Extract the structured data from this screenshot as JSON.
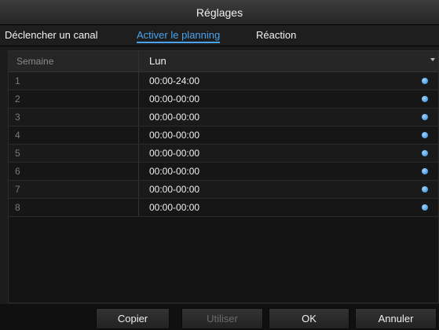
{
  "window": {
    "title": "Réglages"
  },
  "tabs": [
    {
      "label": "Déclencher un canal"
    },
    {
      "label": "Activer le planning"
    },
    {
      "label": "Réaction"
    }
  ],
  "schedule": {
    "day_label": "Semaine",
    "day_value": "Lun",
    "rows": [
      {
        "index": "1",
        "time": "00:00-24:00"
      },
      {
        "index": "2",
        "time": "00:00-00:00"
      },
      {
        "index": "3",
        "time": "00:00-00:00"
      },
      {
        "index": "4",
        "time": "00:00-00:00"
      },
      {
        "index": "5",
        "time": "00:00-00:00"
      },
      {
        "index": "6",
        "time": "00:00-00:00"
      },
      {
        "index": "7",
        "time": "00:00-00:00"
      },
      {
        "index": "8",
        "time": "00:00-00:00"
      }
    ]
  },
  "buttons": {
    "copy": "Copier",
    "apply": "Utiliser",
    "ok": "OK",
    "cancel": "Annuler"
  },
  "colors": {
    "accent": "#4aa3ee",
    "background": "#1c1c1c",
    "indicator": "#2e86d6"
  }
}
